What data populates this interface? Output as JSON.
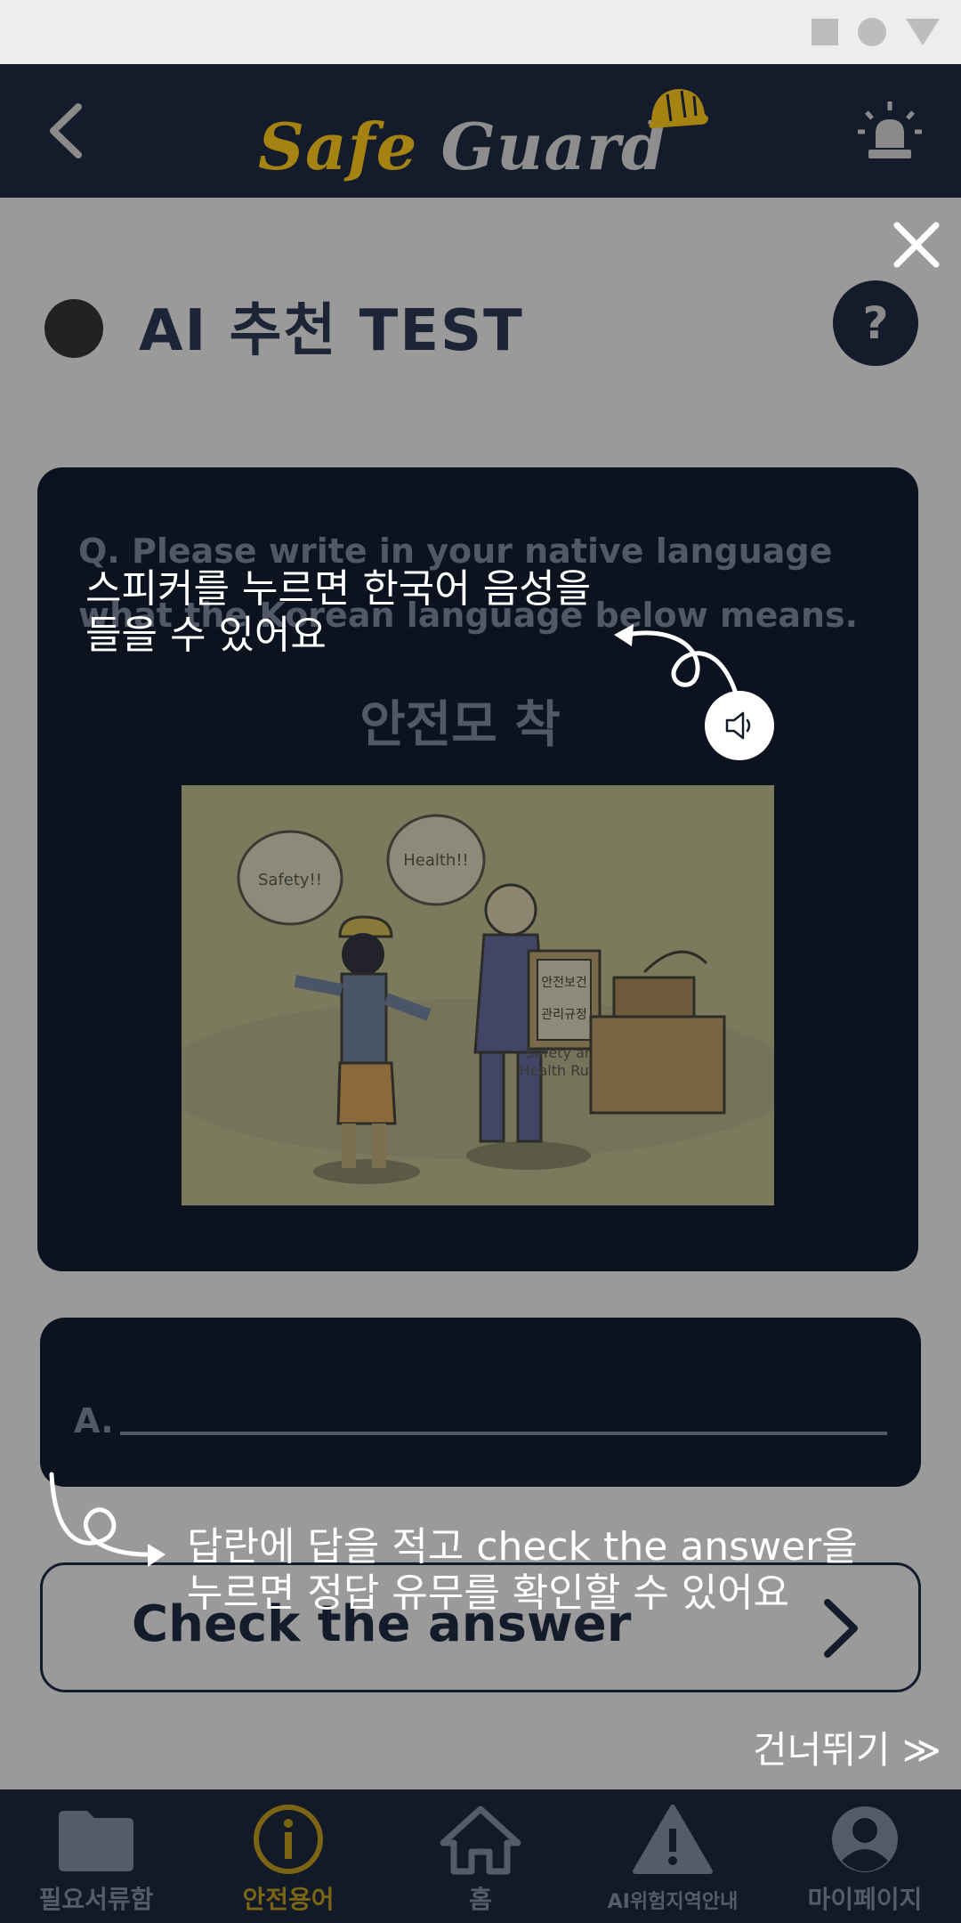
{
  "header": {
    "logo_word1": "Safe",
    "logo_word2": "Guard"
  },
  "page": {
    "title": "AI 추천 TEST",
    "help_label": "?"
  },
  "question": {
    "prompt": "Q. Please write in your native language what the Korean language below means.",
    "word": "안전모 착용",
    "cartoon_bubble1": "Safety!!",
    "cartoon_bubble2": "Health!!",
    "cartoon_sign_line1": "안전보건",
    "cartoon_sign_line2": "관리규정",
    "cartoon_caption_line1": "Safety and",
    "cartoon_caption_line2": "Health Rules"
  },
  "answer": {
    "label": "A.",
    "value": ""
  },
  "check_button": {
    "label": "Check the answer"
  },
  "overlay": {
    "tip_speaker_line1": "스피커를 누르면 한국어 음성을",
    "tip_speaker_line2": "들을 수 있어요",
    "tip_answer_line1": "답란에 답을 적고 check the answer을",
    "tip_answer_line2": "누르면 정답 유무를 확인할 수 있어요",
    "skip_label": "건너뛰기 ≫"
  },
  "bottom_nav": {
    "items": [
      {
        "label": "필요서류함",
        "icon": "folder-icon"
      },
      {
        "label": "안전용어",
        "icon": "info-icon",
        "active": true
      },
      {
        "label": "홈",
        "icon": "home-icon"
      },
      {
        "label": "AI위험지역안내",
        "icon": "warning-icon"
      },
      {
        "label": "마이페이지",
        "icon": "user-icon"
      }
    ]
  },
  "colors": {
    "navy": "#141b2b",
    "card": "#0c131f",
    "dim_overlay": "#9a9a9a",
    "brand_gold": "#a48312",
    "white": "#ffffff"
  }
}
